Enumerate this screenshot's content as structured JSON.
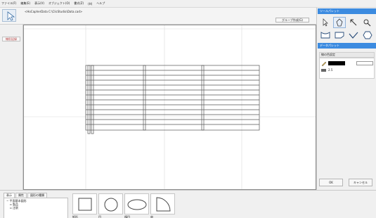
{
  "menu": [
    "ファイル(F)",
    "編集(E)",
    "表示(V)",
    "オブジェクト(O)",
    "書式(Z)",
    "(H)",
    "ヘルプ"
  ],
  "toolbar": {
    "path": "<HoCapherData C:\\ClicStudio\\Data.cad>"
  },
  "canvas": {
    "group_button": "グループ作成(G)"
  },
  "left": {
    "label": "線形記録"
  },
  "panels": {
    "tool_palette_title": "ツールパレット",
    "data_palette_title": "データパレット",
    "prop_name": "線の色設定",
    "line_value": "2.5",
    "ok_label": "OK",
    "cancel_label": "キャンセル"
  },
  "bottom": {
    "tabs": [
      "表示",
      "属性",
      "図形の種類"
    ],
    "tree": [
      "平面基本図形",
      "製品",
      "注釈"
    ],
    "shapes": [
      "矩形",
      "円",
      "楕円",
      "扇"
    ]
  }
}
